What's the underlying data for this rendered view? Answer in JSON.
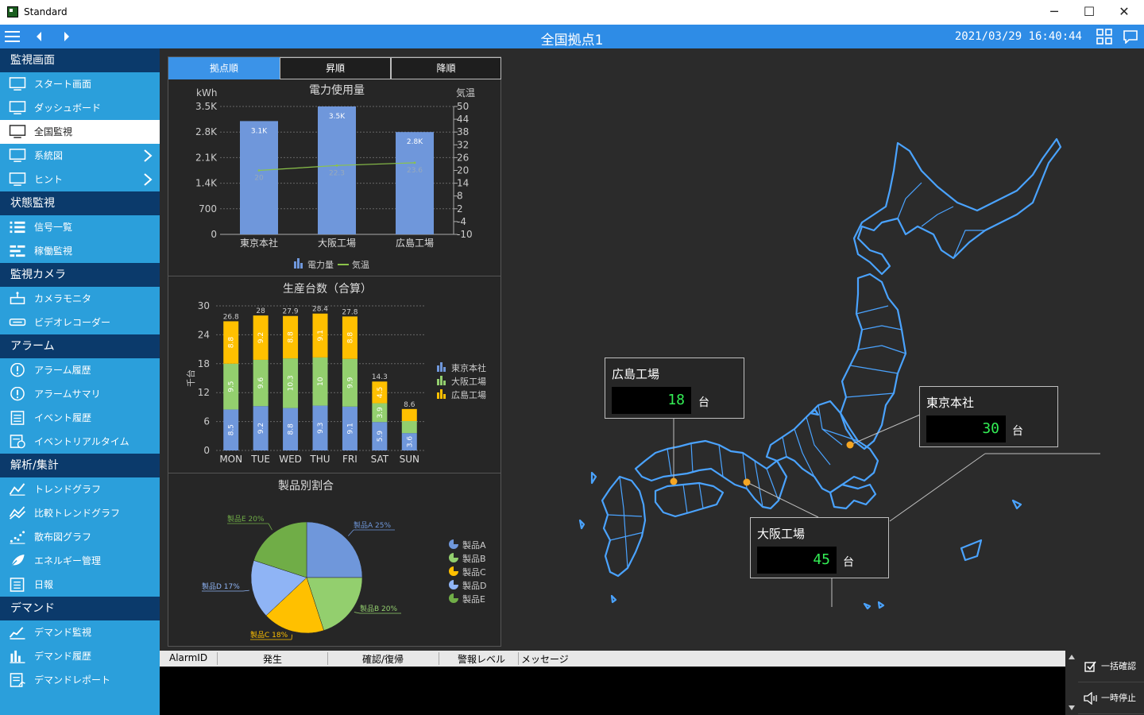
{
  "window": {
    "title": "Standard"
  },
  "appbar": {
    "title": "全国拠点1",
    "datetime": "2021/03/29 16:40:44"
  },
  "sidebar": {
    "sections": [
      {
        "label": "監視画面",
        "items": [
          {
            "label": "スタート画面",
            "icon": "monitor-icon"
          },
          {
            "label": "ダッシュボード",
            "icon": "monitor-icon"
          },
          {
            "label": "全国監視",
            "icon": "monitor-icon",
            "active": true
          },
          {
            "label": "系統図",
            "icon": "monitor-icon",
            "chevron": true
          },
          {
            "label": "ヒント",
            "icon": "monitor-icon",
            "chevron": true
          }
        ]
      },
      {
        "label": "状態監視",
        "items": [
          {
            "label": "信号一覧",
            "icon": "list-icon"
          },
          {
            "label": "稼働監視",
            "icon": "gantt-icon"
          }
        ]
      },
      {
        "label": "監視カメラ",
        "items": [
          {
            "label": "カメラモニタ",
            "icon": "camera-icon"
          },
          {
            "label": "ビデオレコーダー",
            "icon": "recorder-icon"
          }
        ]
      },
      {
        "label": "アラーム",
        "items": [
          {
            "label": "アラーム履歴",
            "icon": "alert-icon"
          },
          {
            "label": "アラームサマリ",
            "icon": "alert-icon"
          },
          {
            "label": "イベント履歴",
            "icon": "event-list-icon"
          },
          {
            "label": "イベントリアルタイム",
            "icon": "event-realtime-icon"
          }
        ]
      },
      {
        "label": "解析/集計",
        "items": [
          {
            "label": "トレンドグラフ",
            "icon": "trend-icon"
          },
          {
            "label": "比較トレンドグラフ",
            "icon": "compare-trend-icon"
          },
          {
            "label": "散布図グラフ",
            "icon": "scatter-icon"
          },
          {
            "label": "エネルギー管理",
            "icon": "leaf-icon"
          },
          {
            "label": "日報",
            "icon": "report-icon"
          }
        ]
      },
      {
        "label": "デマンド",
        "items": [
          {
            "label": "デマンド監視",
            "icon": "demand-icon"
          },
          {
            "label": "デマンド履歴",
            "icon": "bar-icon"
          },
          {
            "label": "デマンドレポート",
            "icon": "demand-report-icon"
          }
        ]
      }
    ]
  },
  "tabs": [
    "拠点順",
    "昇順",
    "降順"
  ],
  "chart_data": [
    {
      "type": "bar",
      "title": "電力使用量",
      "ylabel": "kWh",
      "y2label": "気温",
      "categories": [
        "東京本社",
        "大阪工場",
        "広島工場"
      ],
      "ylim": [
        0,
        3500
      ],
      "yticks": [
        "0",
        "700",
        "1.4K",
        "2.1K",
        "2.8K",
        "3.5K"
      ],
      "y2ticks": [
        "-10",
        "-4",
        "2",
        "8",
        "14",
        "20",
        "26",
        "32",
        "38",
        "44",
        "50"
      ],
      "y2lim": [
        -10,
        50
      ],
      "series": [
        {
          "name": "電力量",
          "type": "bar",
          "values": [
            3100,
            3500,
            2800
          ],
          "labels": [
            "3.1K",
            "3.5K",
            "2.8K"
          ],
          "color": "#6f97db"
        },
        {
          "name": "気温",
          "type": "line",
          "axis": "y2",
          "values": [
            20,
            22.3,
            23.6
          ],
          "labels": [
            "20",
            "22.3",
            "23.6"
          ],
          "color": "#8bc34a"
        }
      ],
      "legend": "bottom"
    },
    {
      "type": "bar",
      "stacked": true,
      "title": "生産台数（合算）",
      "ylabel": "千台",
      "categories": [
        "MON",
        "TUE",
        "WED",
        "THU",
        "FRI",
        "SAT",
        "SUN"
      ],
      "ylim": [
        0,
        30
      ],
      "yticks": [
        "0",
        "6",
        "12",
        "18",
        "24",
        "30"
      ],
      "totals": [
        "26.8",
        "28",
        "27.9",
        "28.4",
        "27.8",
        "14.3",
        "8.6"
      ],
      "series": [
        {
          "name": "東京本社",
          "values": [
            8.5,
            9.2,
            8.8,
            9.3,
            9.1,
            5.9,
            3.6
          ],
          "color": "#6f97db"
        },
        {
          "name": "大阪工場",
          "values": [
            9.5,
            9.6,
            10.3,
            10,
            9.9,
            3.9,
            0
          ],
          "color": "#93cf6e"
        },
        {
          "name": "広島工場",
          "values": [
            8.8,
            9.2,
            8.8,
            9.1,
            8.8,
            4.5,
            0
          ],
          "color": "#ffc000"
        }
      ],
      "extra_segments": {
        "SUN": [
          {
            "series": "大阪工場",
            "value": 0
          },
          {
            "series": "広島工場",
            "value": 0
          }
        ]
      },
      "legend": "right"
    },
    {
      "type": "pie",
      "title": "製品別割合",
      "slices": [
        {
          "name": "製品A",
          "value": 25,
          "label": "製品A 25%",
          "color": "#6f97db"
        },
        {
          "name": "製品B",
          "value": 20,
          "label": "製品B 20%",
          "color": "#93cf6e"
        },
        {
          "name": "製品C",
          "value": 18,
          "label": "製品C 18%",
          "color": "#ffc000"
        },
        {
          "name": "製品D",
          "value": 17,
          "label": "製品D 17%",
          "color": "#8fb4f5"
        },
        {
          "name": "製品E",
          "value": 20,
          "label": "製品E 20%",
          "color": "#70ad47"
        }
      ],
      "legend": "right"
    }
  ],
  "map": {
    "sites": [
      {
        "name": "広島工場",
        "value": "18",
        "unit": "台"
      },
      {
        "name": "東京本社",
        "value": "30",
        "unit": "台"
      },
      {
        "name": "大阪工場",
        "value": "45",
        "unit": "台"
      }
    ]
  },
  "alarm_table": {
    "columns": [
      "AlarmID",
      "発生",
      "確認/復帰",
      "警報レベル",
      "メッセージ"
    ]
  },
  "alarm_buttons": {
    "ack_all": "一括確認",
    "pause": "一時停止"
  },
  "colors": {
    "accent": "#2e8ce6",
    "sidebar": "#2b9fdb",
    "section": "#0b3a6b",
    "map_outline": "#4aa3ff"
  }
}
